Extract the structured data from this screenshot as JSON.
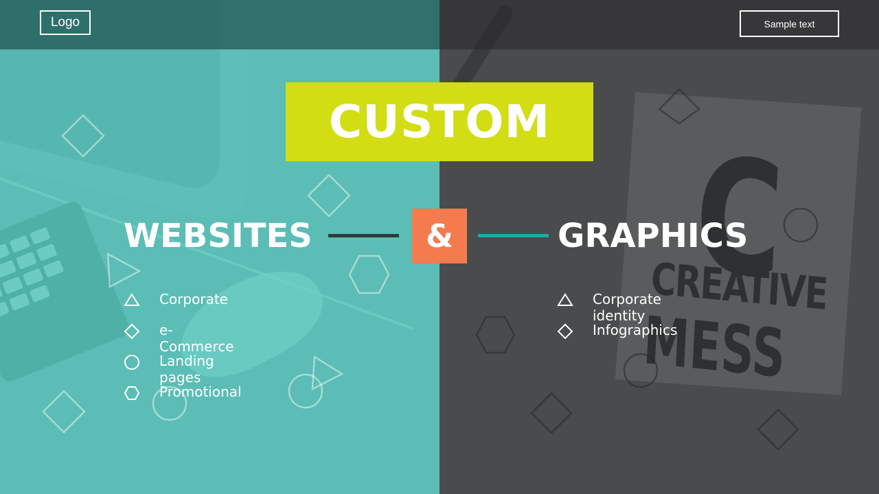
{
  "header": {
    "logo": "Logo",
    "sample_text": "Sample text"
  },
  "title": "CUSTOM",
  "ampersand": "&",
  "websites": {
    "title": "WEBSITES",
    "items": [
      {
        "label": "Corporate",
        "icon": "triangle-icon"
      },
      {
        "label": "e-Commerce",
        "icon": "diamond-icon"
      },
      {
        "label": "Landing pages",
        "icon": "circle-icon"
      },
      {
        "label": "Promotional",
        "icon": "hexagon-icon"
      }
    ]
  },
  "graphics": {
    "title": "GRAPHICS",
    "items": [
      {
        "label": "Corporate identity",
        "icon": "triangle-icon"
      },
      {
        "label": "Infographics",
        "icon": "diamond-icon"
      }
    ]
  },
  "background": {
    "poster_text": [
      "C",
      "CREATIVE",
      "MESS"
    ]
  },
  "colors": {
    "teal": "#5bbdb5",
    "dark": "#4a4b4d",
    "title_bg": "#d2dd13",
    "amp_bg": "#f47b4d",
    "accent_line": "#20a8a4"
  }
}
